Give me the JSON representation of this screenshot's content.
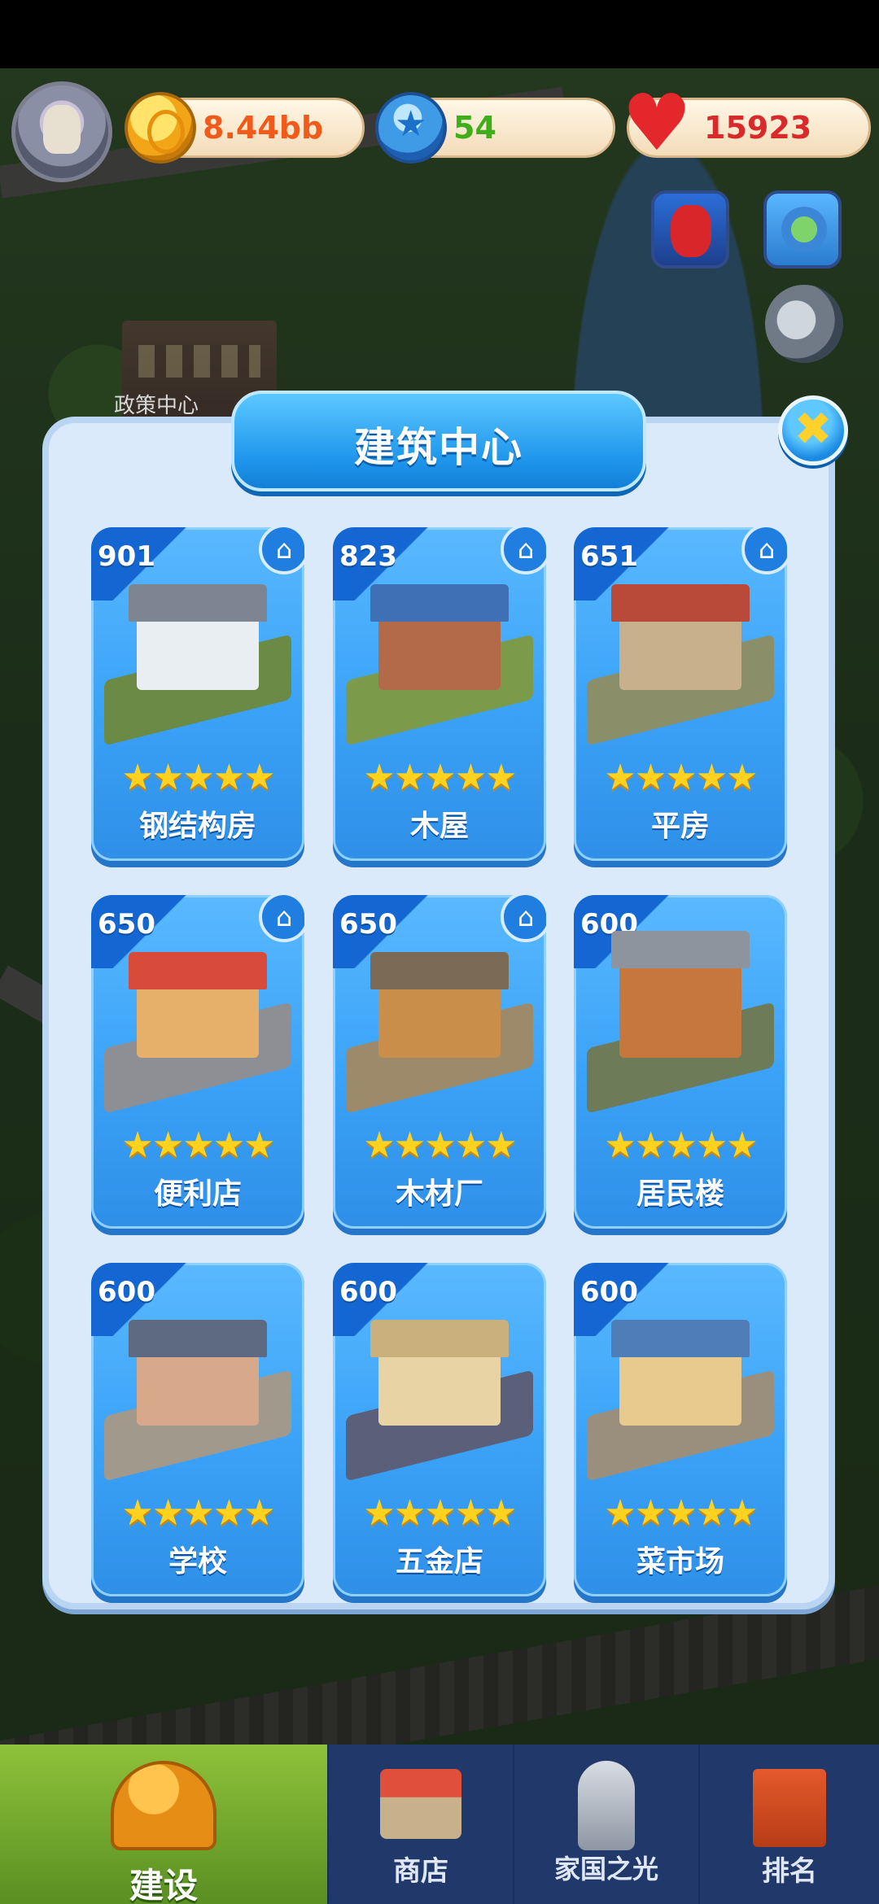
{
  "background": {
    "building_label": "政策中心"
  },
  "hud": {
    "coins": "8.44bb",
    "gems": "54",
    "hearts": "15923"
  },
  "dialog": {
    "title": "建筑中心",
    "close_symbol": "✖",
    "buildings": [
      {
        "count": "901",
        "name": "钢结构房",
        "stars": 5,
        "owned": true
      },
      {
        "count": "823",
        "name": "木屋",
        "stars": 5,
        "owned": true
      },
      {
        "count": "651",
        "name": "平房",
        "stars": 5,
        "owned": true
      },
      {
        "count": "650",
        "name": "便利店",
        "stars": 5,
        "owned": true
      },
      {
        "count": "650",
        "name": "木材厂",
        "stars": 5,
        "owned": true
      },
      {
        "count": "600",
        "name": "居民楼",
        "stars": 5,
        "owned": false
      },
      {
        "count": "600",
        "name": "学校",
        "stars": 5,
        "owned": false
      },
      {
        "count": "600",
        "name": "五金店",
        "stars": 5,
        "owned": false
      },
      {
        "count": "600",
        "name": "菜市场",
        "stars": 5,
        "owned": false
      }
    ],
    "stars_text": "★★★★★",
    "home_icon": "⌂"
  },
  "nav": {
    "build": "建设",
    "shop": "商店",
    "homeland": "家国之光",
    "rank": "排名"
  },
  "colors": {
    "accent": "#1f96ec",
    "coin_text": "#f05a1a",
    "gem_text": "#3fae1a",
    "heart_text": "#d82a2a",
    "nav_active": "#7fb52f"
  }
}
